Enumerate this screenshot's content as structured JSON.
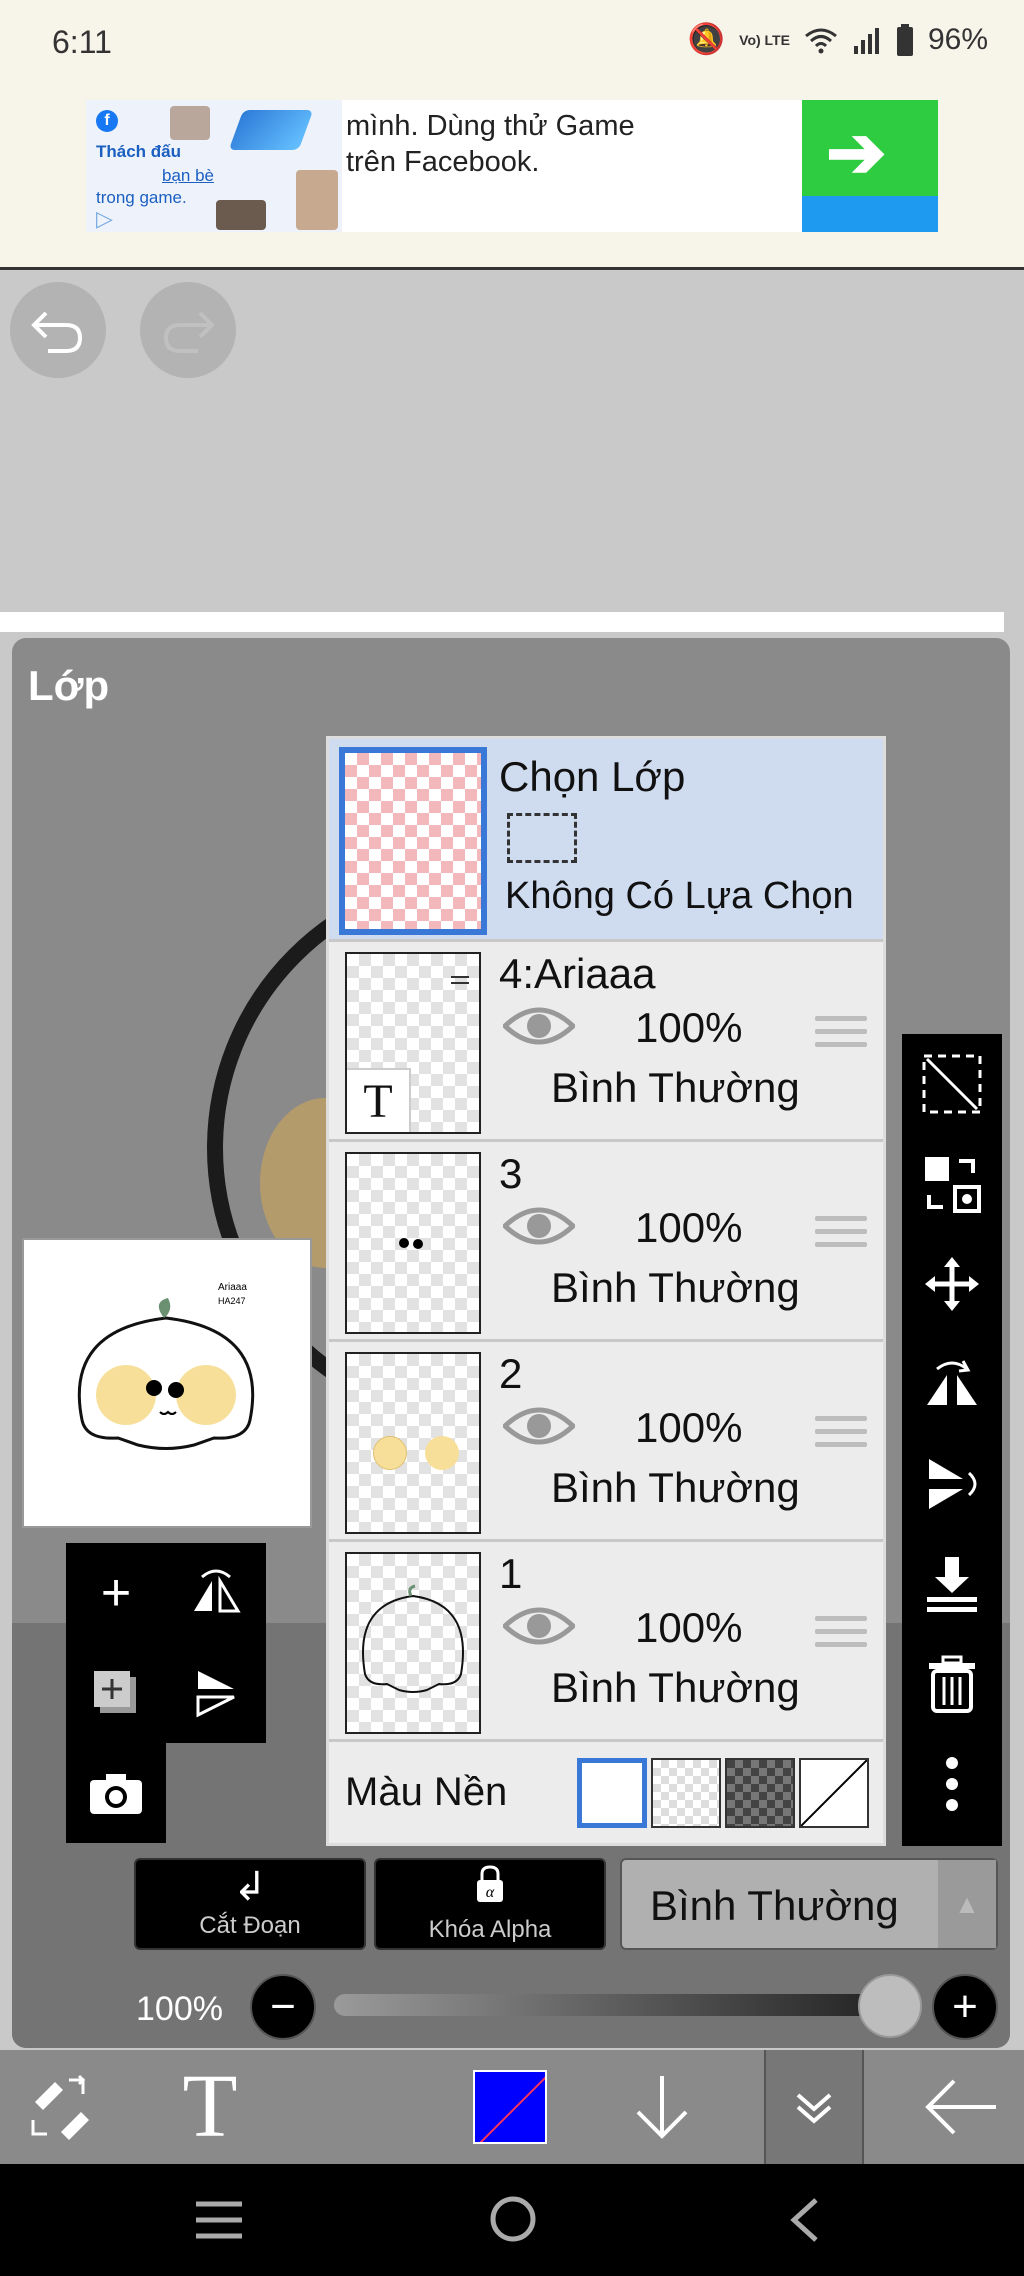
{
  "status": {
    "time": "6:11",
    "network": "Vo) LTE",
    "battery": "96%",
    "icons": [
      "mute-icon",
      "wifi-icon",
      "signal-icon",
      "battery-icon"
    ]
  },
  "ad": {
    "thumb_title": "Thách đấu",
    "thumb_link": "bạn bè",
    "thumb_sub": "trong game.",
    "body": "mình. Dùng thử Game trên Facebook.",
    "arrow_color": "#2ecc40"
  },
  "layers_panel": {
    "title": "Lớp",
    "select_layer": {
      "title": "Chọn Lớp",
      "subtitle": "Không Có Lựa Chọn"
    },
    "layers": [
      {
        "name": "4:Ariaaa",
        "opacity": "100%",
        "blend": "Bình Thường"
      },
      {
        "name": "3",
        "opacity": "100%",
        "blend": "Bình Thường"
      },
      {
        "name": "2",
        "opacity": "100%",
        "blend": "Bình Thường"
      },
      {
        "name": "1",
        "opacity": "100%",
        "blend": "Bình Thường"
      }
    ],
    "background": {
      "label": "Màu Nền"
    },
    "clip_label": "Cắt Đoạn",
    "alpha_lock_label": "Khóa Alpha",
    "blend_mode": "Bình Thường",
    "opacity_label": "100%",
    "opacity_value": 1.0
  },
  "preview": {
    "text1": "Ariaaa",
    "text2": "HA247"
  },
  "toolbar": {
    "text_tool": "T",
    "current_color": "#0000ff"
  }
}
